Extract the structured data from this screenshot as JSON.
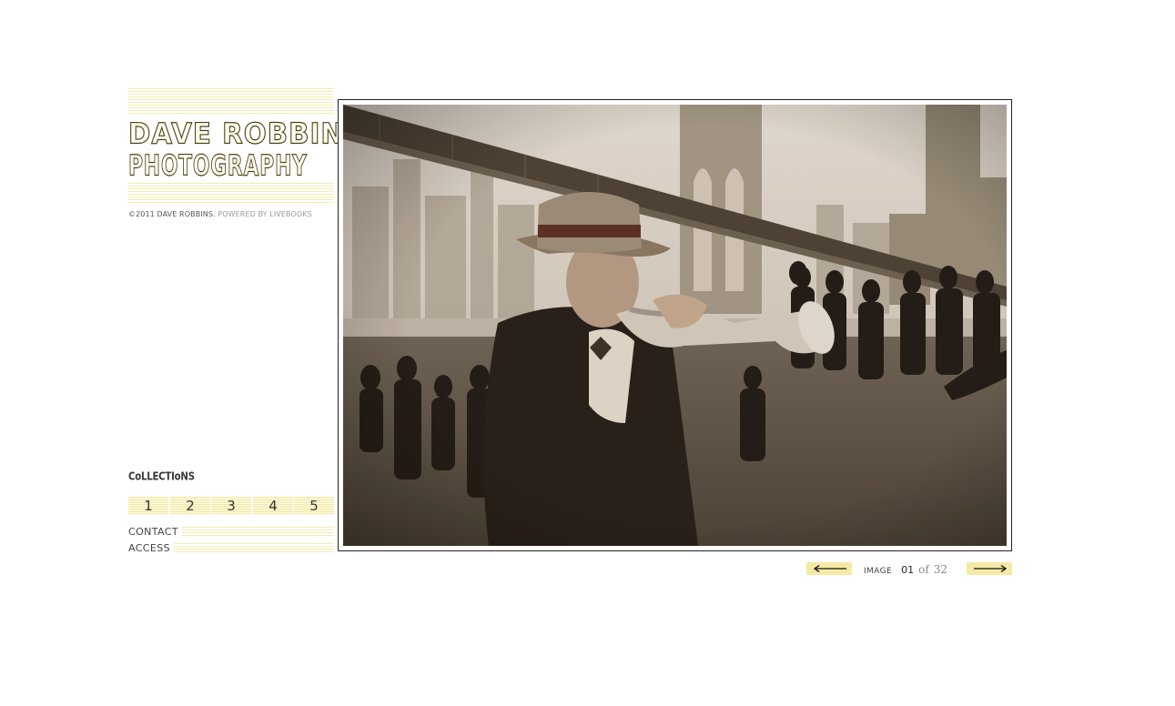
{
  "logo": {
    "line1": "DAVE ROBBINS",
    "line2": "PHOTOGRAPHY"
  },
  "footer": {
    "copyright": "©2011 DAVE ROBBINS.",
    "powered": "POWERED BY LIVEBOOKS"
  },
  "collections": {
    "title": "CoLLECTIoNS",
    "items": [
      "1",
      "2",
      "3",
      "4",
      "5"
    ]
  },
  "menu": {
    "contact": "CONTACT",
    "access": "ACCESS"
  },
  "viewer": {
    "image_label": "IMAGE",
    "current": "01",
    "of": "of",
    "total": "32"
  },
  "icons": {
    "prev": "arrow-left-icon",
    "next": "arrow-right-icon"
  },
  "colors": {
    "accent_yellow": "#f5eaa4",
    "logo_gold": "#4a4214"
  }
}
